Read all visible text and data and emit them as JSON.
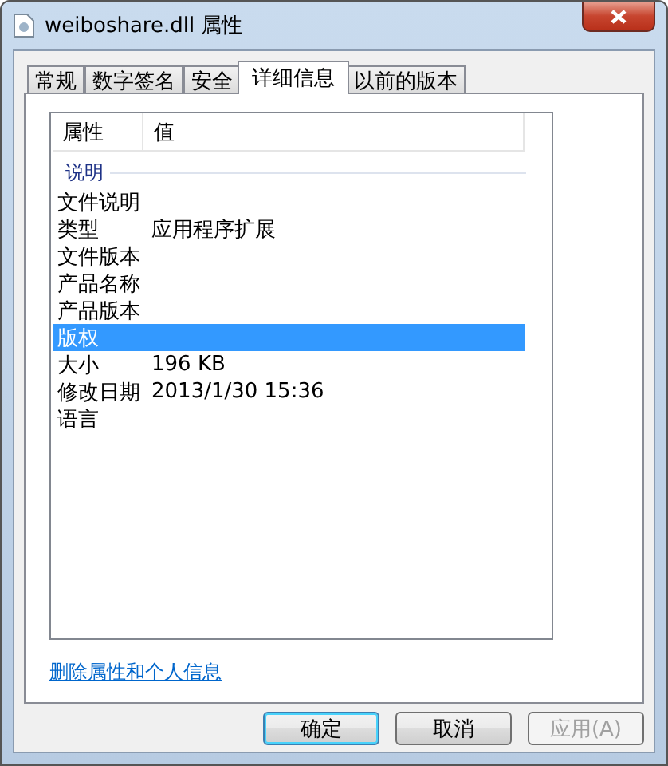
{
  "window": {
    "title": "weiboshare.dll 属性"
  },
  "tabs": [
    {
      "label": "常规",
      "selected": false
    },
    {
      "label": "数字签名",
      "selected": false
    },
    {
      "label": "安全",
      "selected": false
    },
    {
      "label": "详细信息",
      "selected": true
    },
    {
      "label": "以前的版本",
      "selected": false
    }
  ],
  "list": {
    "columns": [
      "属性",
      "值"
    ],
    "group": "说明",
    "rows": [
      {
        "name": "文件说明",
        "value": "",
        "selected": false
      },
      {
        "name": "类型",
        "value": "应用程序扩展",
        "selected": false
      },
      {
        "name": "文件版本",
        "value": "",
        "selected": false
      },
      {
        "name": "产品名称",
        "value": "",
        "selected": false
      },
      {
        "name": "产品版本",
        "value": "",
        "selected": false
      },
      {
        "name": "版权",
        "value": "",
        "selected": true
      },
      {
        "name": "大小",
        "value": "196 KB",
        "selected": false
      },
      {
        "name": "修改日期",
        "value": "2013/1/30 15:36",
        "selected": false
      },
      {
        "name": "语言",
        "value": "",
        "selected": false
      }
    ]
  },
  "link": "删除属性和个人信息",
  "buttons": [
    {
      "label": "确定",
      "default": true,
      "disabled": false
    },
    {
      "label": "取消",
      "default": false,
      "disabled": false
    },
    {
      "label": "应用(A)",
      "default": false,
      "disabled": true
    }
  ]
}
